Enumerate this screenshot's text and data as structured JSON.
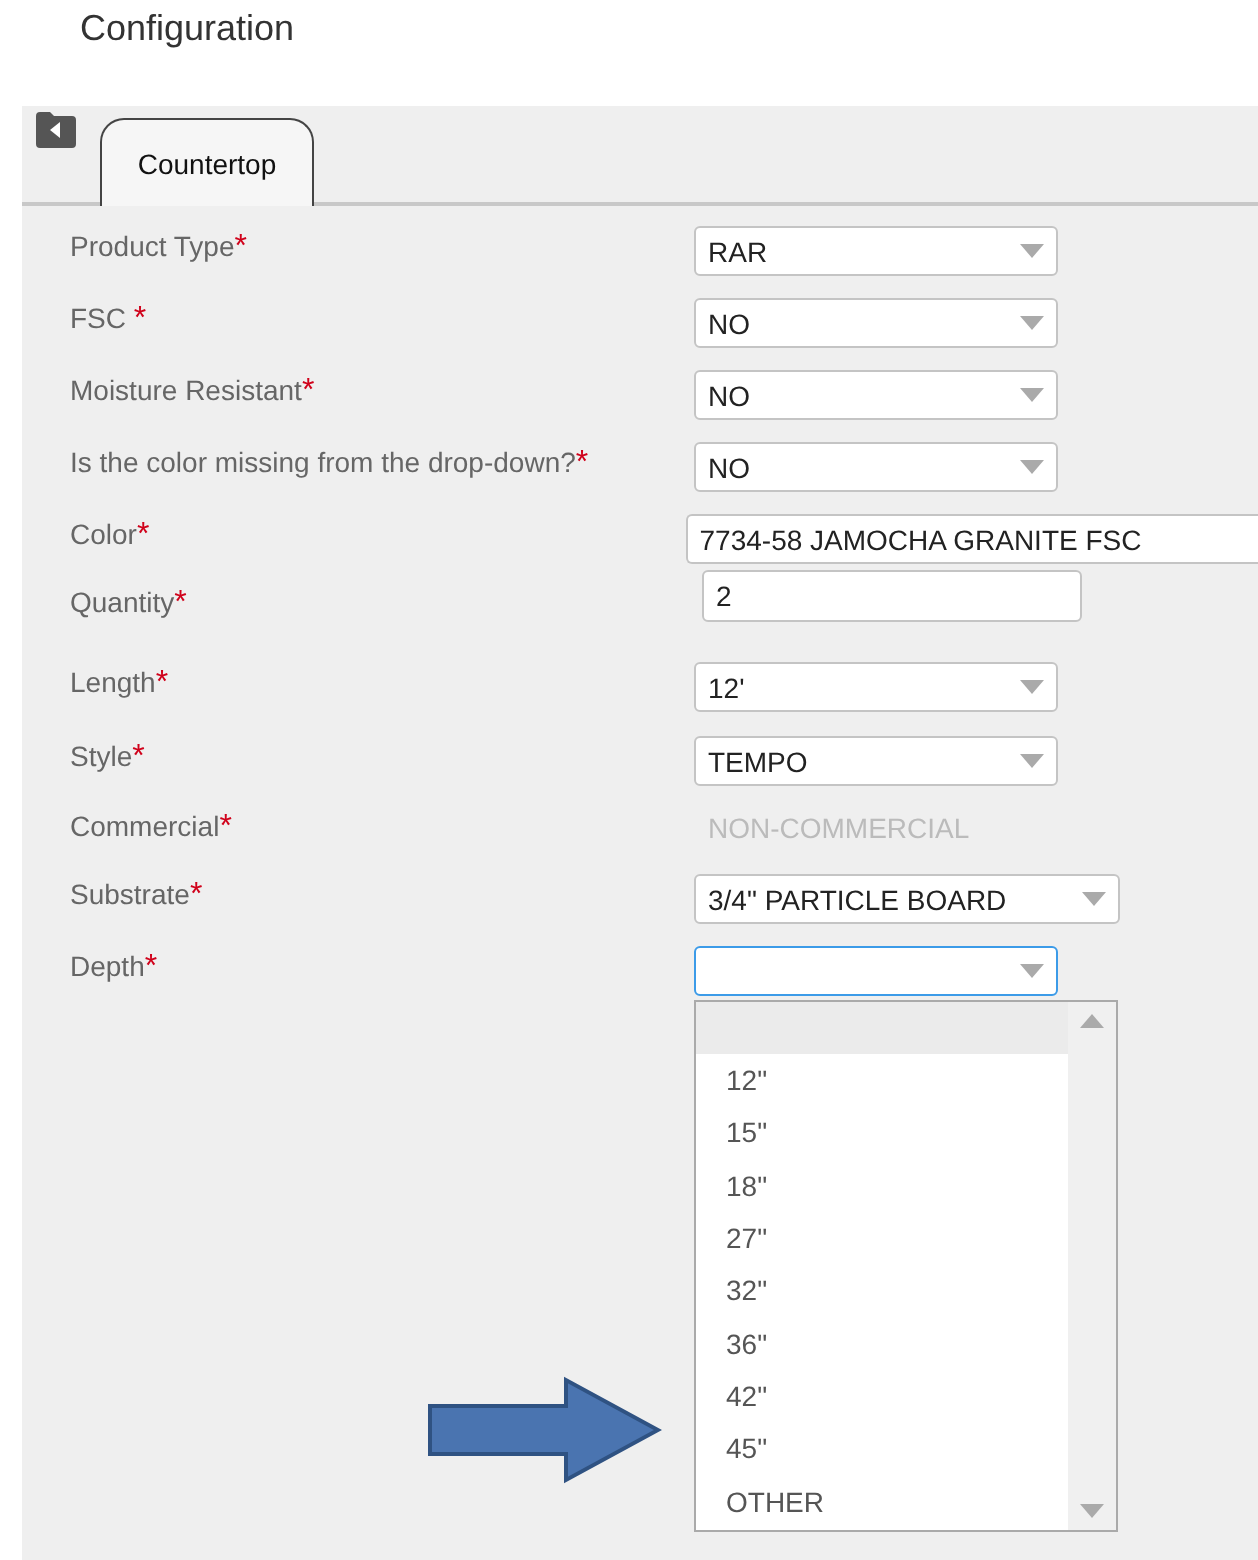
{
  "page_title": "Configuration",
  "tabs": [
    {
      "label": "Countertop",
      "selected": true
    }
  ],
  "fields": [
    {
      "label": "Product Type",
      "required_mark": "*",
      "kind": "select",
      "value": "RAR"
    },
    {
      "label": "FSC ",
      "required_mark": "*",
      "kind": "select",
      "value": "NO"
    },
    {
      "label": "Moisture Resistant",
      "required_mark": "*",
      "kind": "select",
      "value": "NO"
    },
    {
      "label": "Is the color missing from the drop-down?",
      "required_mark": "*",
      "kind": "select",
      "value": "NO"
    },
    {
      "label": "Color",
      "required_mark": "*",
      "kind": "wide",
      "value": "7734-58 JAMOCHA GRANITE FSC"
    },
    {
      "label": "Quantity",
      "required_mark": "*",
      "kind": "input",
      "value": "2"
    },
    {
      "label": "Length",
      "required_mark": "*",
      "kind": "select",
      "value": "12'"
    },
    {
      "label": "Style",
      "required_mark": "*",
      "kind": "select",
      "value": "TEMPO"
    },
    {
      "label": "Commercial",
      "required_mark": "*",
      "kind": "static",
      "value": "NON-COMMERCIAL"
    },
    {
      "label": "Substrate",
      "required_mark": "*",
      "kind": "select_wide",
      "value": "3/4\" PARTICLE BOARD"
    },
    {
      "label": "Depth",
      "required_mark": "*",
      "kind": "select",
      "focused": true
    }
  ],
  "dropdown": {
    "blank_highlighted": true,
    "options": [
      "12\"",
      "15\"",
      "18\"",
      "27\"",
      "32\"",
      "36\"",
      "42\"",
      "45\"",
      "OTHER"
    ]
  }
}
